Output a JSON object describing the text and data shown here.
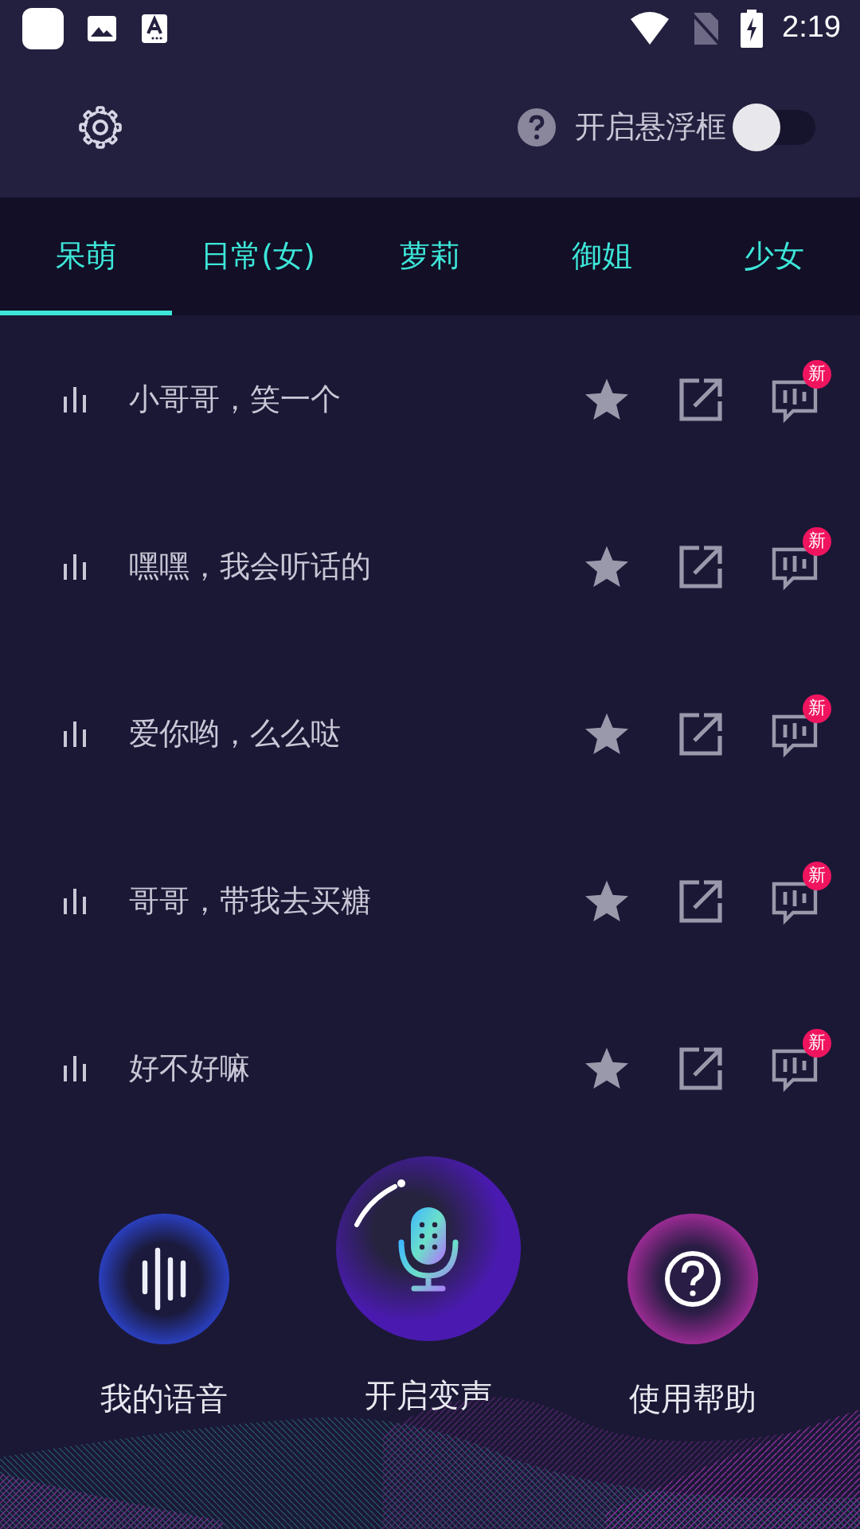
{
  "status_bar": {
    "time": "2:19"
  },
  "header": {
    "toggle": {
      "label": "开启悬浮框",
      "on": false
    }
  },
  "tabs": [
    {
      "label": "呆萌",
      "selected": true
    },
    {
      "label": "日常(女)",
      "selected": false
    },
    {
      "label": "萝莉",
      "selected": false
    },
    {
      "label": "御姐",
      "selected": false
    },
    {
      "label": "少女",
      "selected": false
    }
  ],
  "phrases": [
    {
      "text": "小哥哥，笑一个",
      "badge": "新"
    },
    {
      "text": "嘿嘿，我会听话的",
      "badge": "新"
    },
    {
      "text": "爱你哟，么么哒",
      "badge": "新"
    },
    {
      "text": "哥哥，带我去买糖",
      "badge": "新"
    },
    {
      "text": "好不好嘛",
      "badge": "新"
    }
  ],
  "bottom_actions": [
    {
      "kind": "voices",
      "label": "我的语音"
    },
    {
      "kind": "mic",
      "label": "开启变声"
    },
    {
      "kind": "help",
      "label": "使用帮助"
    }
  ]
}
